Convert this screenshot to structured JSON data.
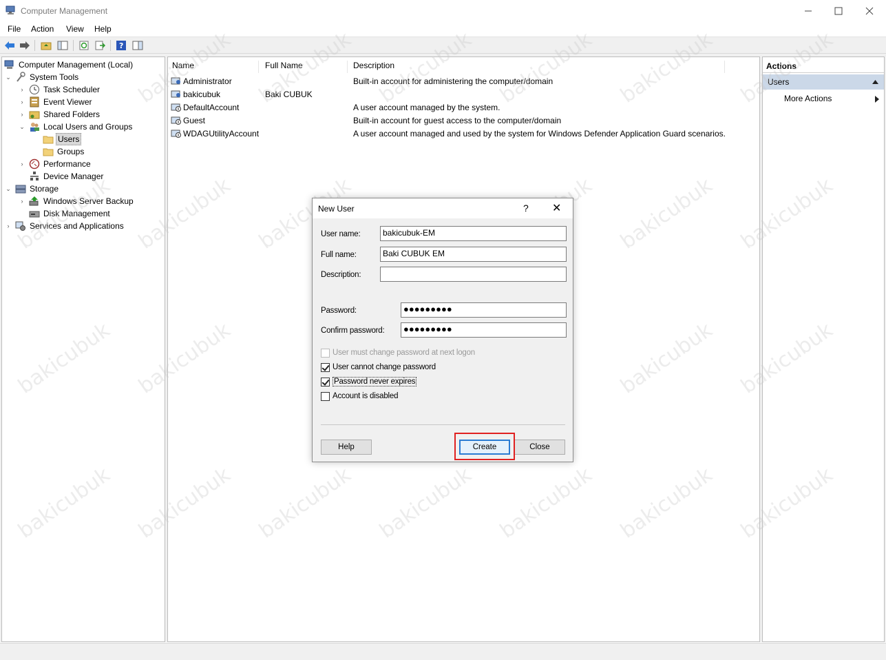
{
  "window": {
    "title": "Computer Management",
    "controls": [
      "minimize",
      "maximize",
      "close"
    ]
  },
  "menu": [
    "File",
    "Action",
    "View",
    "Help"
  ],
  "tree": [
    {
      "label": "Computer Management (Local)",
      "icon": "computer-management-icon"
    },
    {
      "label": "System Tools",
      "icon": "tools-icon"
    },
    {
      "label": "Task Scheduler",
      "icon": "clock-icon"
    },
    {
      "label": "Event Viewer",
      "icon": "event-viewer-icon"
    },
    {
      "label": "Shared Folders",
      "icon": "shared-folder-icon"
    },
    {
      "label": "Local Users and Groups",
      "icon": "users-groups-icon"
    },
    {
      "label": "Users",
      "icon": "folder-icon"
    },
    {
      "label": "Groups",
      "icon": "folder-icon"
    },
    {
      "label": "Performance",
      "icon": "performance-icon"
    },
    {
      "label": "Device Manager",
      "icon": "device-manager-icon"
    },
    {
      "label": "Storage",
      "icon": "storage-icon"
    },
    {
      "label": "Windows Server Backup",
      "icon": "backup-icon"
    },
    {
      "label": "Disk Management",
      "icon": "disk-icon"
    },
    {
      "label": "Services and Applications",
      "icon": "services-icon"
    }
  ],
  "list": {
    "columns": [
      "Name",
      "Full Name",
      "Description"
    ],
    "rows": [
      {
        "name": "Administrator",
        "full_name": "",
        "description": "Built-in account for administering the computer/domain"
      },
      {
        "name": "bakicubuk",
        "full_name": "Baki CUBUK",
        "description": ""
      },
      {
        "name": "DefaultAccount",
        "full_name": "",
        "description": "A user account managed by the system."
      },
      {
        "name": "Guest",
        "full_name": "",
        "description": "Built-in account for guest access to the computer/domain"
      },
      {
        "name": "WDAGUtilityAccount",
        "full_name": "",
        "description": "A user account managed and used by the system for Windows Defender Application Guard scenarios."
      }
    ]
  },
  "actions": {
    "header": "Actions",
    "section": "Users",
    "more": "More Actions"
  },
  "dialog": {
    "title": "New User",
    "help_glyph": "?",
    "close_glyph": "✕",
    "user_name_label": "User name:",
    "user_name_value": "bakicubuk-EM",
    "full_name_label": "Full name:",
    "full_name_value": "Baki CUBUK EM",
    "description_label": "Description:",
    "description_value": "",
    "password_label": "Password:",
    "password_value": "●●●●●●●●●",
    "confirm_label": "Confirm password:",
    "confirm_value": "●●●●●●●●●",
    "options": [
      {
        "label": "User must change password at next logon",
        "checked": false,
        "disabled": true
      },
      {
        "label": "User cannot change password",
        "checked": true,
        "disabled": false
      },
      {
        "label": "Password never expires",
        "checked": true,
        "disabled": false
      },
      {
        "label": "Account is disabled",
        "checked": false,
        "disabled": false
      }
    ],
    "help_button": "Help",
    "create_button": "Create",
    "close_button": "Close"
  },
  "watermark": "bakicubuk",
  "colors": {
    "selection": "#cbd8e8",
    "default_button_border": "#2a7bd3",
    "annotation": "#e02020"
  }
}
